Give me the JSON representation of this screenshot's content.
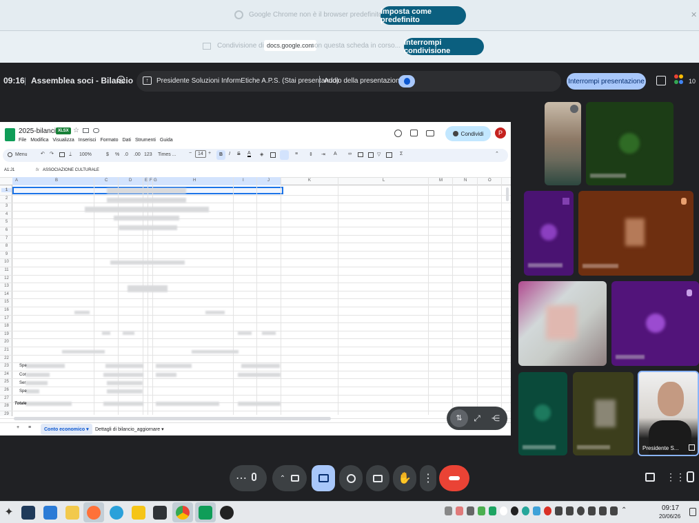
{
  "chrome_bar": {
    "message": "Google Chrome non è il browser predefinito",
    "set_default": "Imposta come predefinito",
    "sharing_pre": "Condivisione di",
    "sharing_domain": "docs.google.com",
    "sharing_post": "con questa scheda in corso...",
    "stop_sharing": "Interrompi condivisione"
  },
  "meet": {
    "time": "09:16",
    "separator": "|",
    "title": "Assemblea soci - Bilancio",
    "presenting": "Presidente Soluzioni InformEtiche A.P.S. (Stai presentando)",
    "audio": "Audio della presentazione",
    "stop_presentation": "Interrompi presentazione",
    "participants_count": "10",
    "self_name": "Presidente S..."
  },
  "sheet": {
    "filename": "2025-bilancio",
    "badge": "XLSX",
    "menus": [
      "File",
      "Modifica",
      "Visualizza",
      "Inserisci",
      "Formato",
      "Dati",
      "Strumenti",
      "Guida"
    ],
    "share": "Condividi",
    "avatar": "P",
    "search": "Menu",
    "zoom": "100%",
    "currency": "$",
    "percent": "%",
    "dec1": ".0",
    "dec2": ".00",
    "num": "123",
    "font": "Times ...",
    "font_size": "14",
    "cell_ref": "A1:J1",
    "fx": "fx",
    "formula": "ASSOCIAZIONE CULTURALE",
    "columns": [
      "A",
      "B",
      "C",
      "D",
      "E",
      "F",
      "G",
      "H",
      "I",
      "J",
      "K",
      "L",
      "M",
      "N",
      "O"
    ],
    "rows": [
      "1",
      "2",
      "3",
      "4",
      "5",
      "6",
      "7",
      "8",
      "9",
      "10",
      "11",
      "12",
      "13",
      "14",
      "15",
      "16",
      "17",
      "18",
      "19",
      "20",
      "21",
      "22",
      "23",
      "24",
      "25",
      "26",
      "27",
      "28",
      "29"
    ],
    "row_labels": {
      "r22": "Spe",
      "r23": "Cor",
      "r24": "Ser",
      "r25": "Spe",
      "r28": "Totale"
    },
    "tabs": [
      "Conto economico",
      "Dettagli di bilancio_aggiornare"
    ]
  },
  "taskbar": {
    "clock_time": "09:17",
    "clock_date": "20/06/26"
  }
}
